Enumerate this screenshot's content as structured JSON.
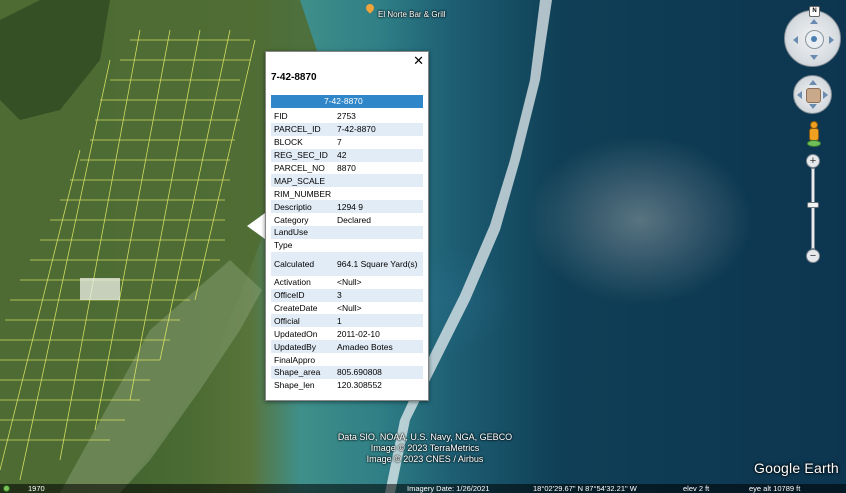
{
  "map": {
    "place_label": "El Norte Bar & Grill",
    "credits": [
      "Data SIO, NOAA, U.S. Navy, NGA, GEBCO",
      "Image © 2023 TerraMetrics",
      "Image © 2023 CNES / Airbus"
    ],
    "logo": "Google Earth",
    "colors": {
      "parcel_lines": "#e8f06a",
      "water_deep": "#0d3550",
      "water_shallow": "#3f8f8a",
      "land": "#4a6b33"
    }
  },
  "popup": {
    "title": "7-42-8870",
    "close_icon": "close-icon",
    "header_value": "7-42-8870",
    "header_color": "#2f86c8",
    "rows": [
      {
        "key": "FID",
        "value": "2753"
      },
      {
        "key": "PARCEL_ID",
        "value": "7-42-8870"
      },
      {
        "key": "BLOCK",
        "value": "7"
      },
      {
        "key": "REG_SEC_ID",
        "value": "42"
      },
      {
        "key": "PARCEL_NO",
        "value": "8870"
      },
      {
        "key": "MAP_SCALE",
        "value": ""
      },
      {
        "key": "RIM_NUMBER",
        "value": ""
      },
      {
        "key": "Descriptio",
        "value": "1294 9"
      },
      {
        "key": "Category",
        "value": "Declared"
      },
      {
        "key": "LandUse",
        "value": ""
      },
      {
        "key": "Type",
        "value": ""
      },
      {
        "key": "Calculated",
        "value": "964.1 Square Yard(s)"
      },
      {
        "key": "Activation",
        "value": "<Null>"
      },
      {
        "key": "OfficeID",
        "value": "3"
      },
      {
        "key": "CreateDate",
        "value": "<Null>"
      },
      {
        "key": "Official",
        "value": "1"
      },
      {
        "key": "UpdatedOn",
        "value": "2011-02-10"
      },
      {
        "key": "UpdatedBy",
        "value": "Amadeo Botes"
      },
      {
        "key": "FinalAppro",
        "value": ""
      },
      {
        "key": "Shape_area",
        "value": "805.690808"
      },
      {
        "key": "Shape_len",
        "value": "120.308552"
      }
    ]
  },
  "controls": {
    "north_label": "N",
    "zoom_in": "+",
    "zoom_out": "−"
  },
  "status": {
    "year": "1970",
    "imagery_date": "Imagery Date: 1/26/2021",
    "coords": "18°02'29.67\" N    87°54'32.21\" W",
    "elev": "elev    2 ft",
    "eye_alt": "eye alt  10789 ft"
  }
}
